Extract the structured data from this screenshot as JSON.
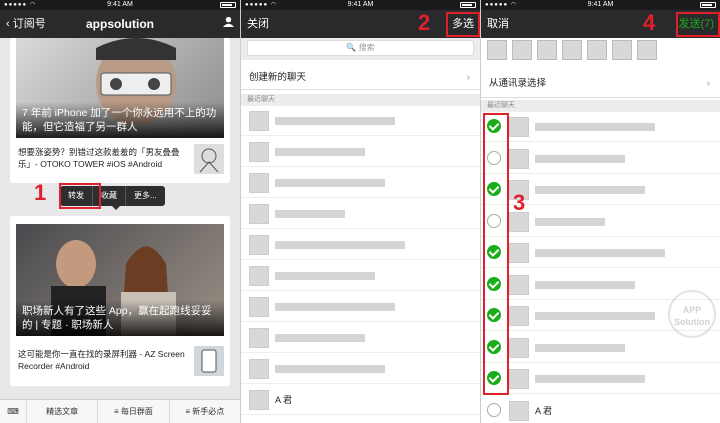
{
  "status_time": "9:41 AM",
  "panel1": {
    "back_label": "订阅号",
    "title": "appsolution",
    "article1": {
      "caption": "7 年前 iPhone 加了一个你永远用不上的功能，但它造福了另一群人",
      "body": "想要涨姿势？别错过这款羞羞的「男友叠叠乐」- OTOKO TOWER #iOS #Android"
    },
    "menu": [
      "转发",
      "收藏",
      "更多..."
    ],
    "article2": {
      "caption": "职场新人有了这些 App，赢在起跑线妥妥的 | 专题 · 职场新人",
      "body": "这可能是你一直在找的录屏利器 - AZ Screen Recorder #Android"
    },
    "tabs": [
      "精选文章",
      "每日群面",
      "新手必点"
    ],
    "tab_prefix": [
      "",
      "≡",
      "≡"
    ],
    "step": "1"
  },
  "panel2": {
    "close_label": "关闭",
    "multi_label": "多选",
    "search_placeholder": "搜索",
    "new_chat": "创建新的聊天",
    "recent_header": "最近聊天",
    "last_name": "A 君",
    "step": "2"
  },
  "panel3": {
    "cancel_label": "取消",
    "send_label": "发送(7)",
    "from_contacts": "从通讯录选择",
    "recent_header": "最近聊天",
    "last_name": "A 君",
    "step3": "3",
    "step4": "4",
    "checks": [
      true,
      false,
      true,
      false,
      true,
      true,
      true,
      true,
      true,
      false
    ]
  },
  "watermark": [
    "APP",
    "Solution"
  ],
  "colors": {
    "accent_red": "#e0212b",
    "wechat_green": "#1aad19",
    "nav_dark": "#2a2a2c"
  }
}
